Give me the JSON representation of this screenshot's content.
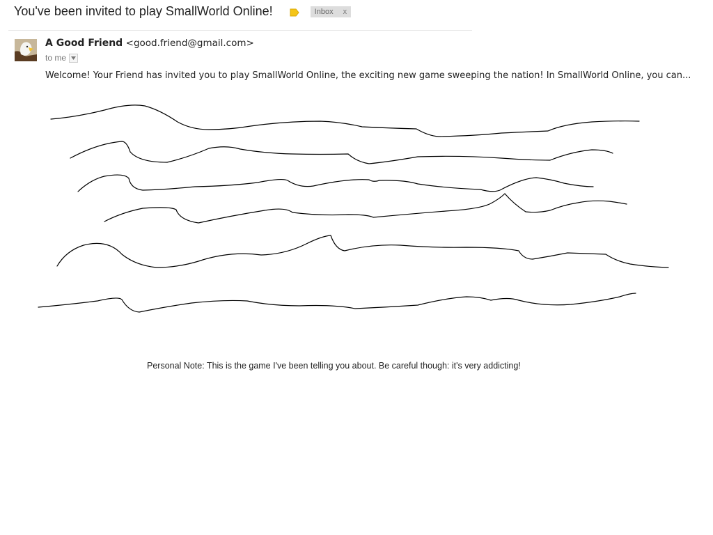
{
  "email": {
    "subject": "You've been invited to play SmallWorld Online!",
    "label": "Inbox",
    "label_remove": "x",
    "sender_name": "A Good Friend",
    "sender_email": "<good.friend@gmail.com>",
    "recipient": "to me",
    "body": "Welcome! Your Friend has invited you to play SmallWorld Online, the exciting new game sweeping the nation! In SmallWorld Online, you can...",
    "personal_note": "Personal Note: This is the game I've been telling you about. Be careful though: it's very addicting!"
  },
  "icons": {
    "importance_marker": "label-tag-icon",
    "avatar": "eagle-avatar-icon",
    "details_dropdown": "chevron-down-icon"
  },
  "colors": {
    "importance_marker": "#f5c518",
    "chip_bg": "#dddddd",
    "scribble": "#000000"
  }
}
